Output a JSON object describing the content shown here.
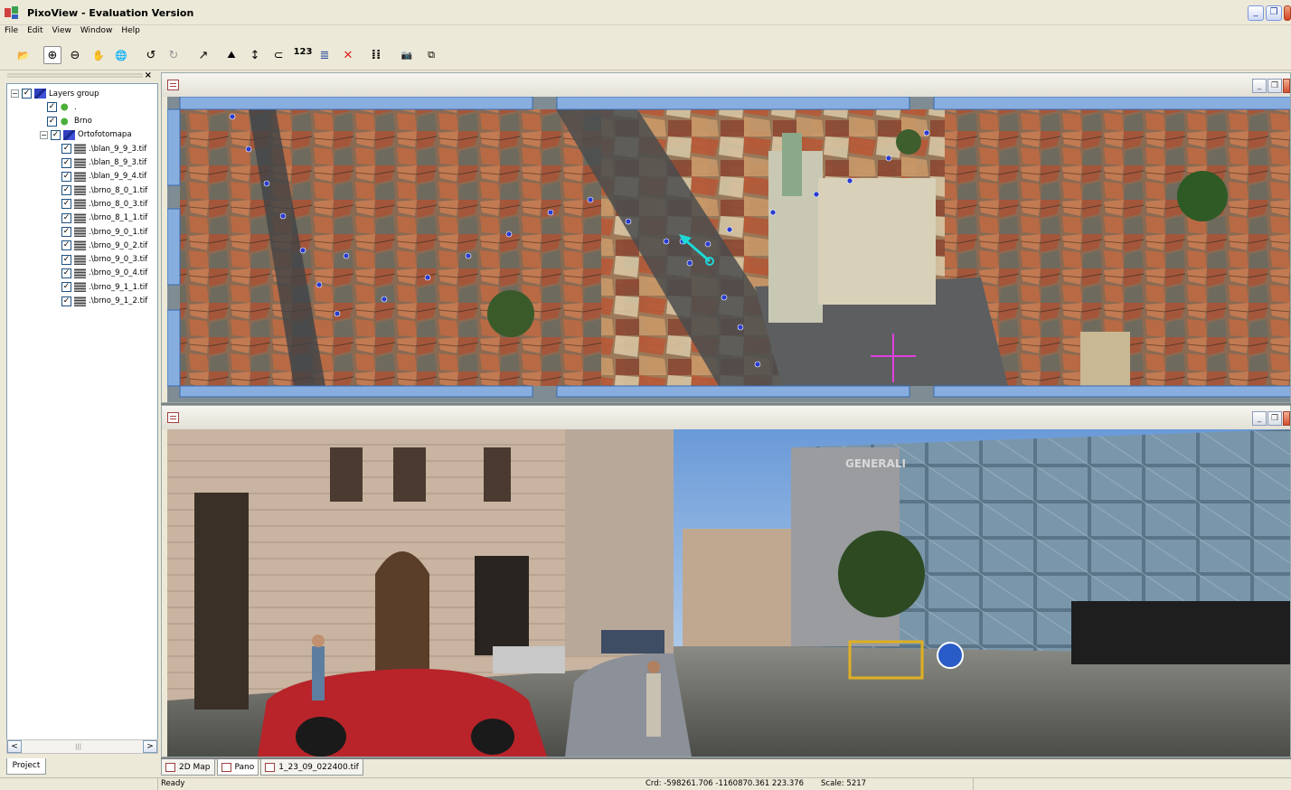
{
  "window": {
    "title": "PixoView - Evaluation Version",
    "min_glyph": "_",
    "max_glyph": "❐"
  },
  "menu": [
    "File",
    "Edit",
    "View",
    "Window",
    "Help"
  ],
  "toolbar": {
    "tools": [
      {
        "name": "open-icon",
        "glyph": "📂"
      },
      {
        "name": "zoom-in-icon",
        "glyph": "⊕"
      },
      {
        "name": "zoom-out-icon",
        "glyph": "⊖"
      },
      {
        "name": "pan-hand-icon",
        "glyph": "✋"
      },
      {
        "name": "globe-icon",
        "glyph": "🌐"
      },
      {
        "name": "rotate-left-icon",
        "glyph": "↺"
      },
      {
        "name": "rotate-right-icon",
        "glyph": "↻"
      },
      {
        "name": "arrow-icon",
        "glyph": "↗"
      },
      {
        "name": "measure-area-icon",
        "glyph": "⛰"
      },
      {
        "name": "measure-height-icon",
        "glyph": "↕"
      },
      {
        "name": "measure-distance-icon",
        "glyph": "⊂"
      },
      {
        "name": "numbering-icon",
        "glyph": "123"
      },
      {
        "name": "layers-list-icon",
        "glyph": "≣"
      },
      {
        "name": "delete-icon",
        "glyph": "✕"
      },
      {
        "name": "points-grid-icon",
        "glyph": "⁞⁞"
      },
      {
        "name": "camera-icon",
        "glyph": "📷"
      },
      {
        "name": "copy-icon",
        "glyph": "⧉"
      }
    ],
    "colors": {
      "delete": "#e02020",
      "globe": "#2a7a30"
    }
  },
  "sidebar": {
    "close_glyph": "×",
    "tree": [
      {
        "level": 0,
        "expander": "⊟",
        "icon": "layers",
        "label": "Layers group"
      },
      {
        "level": 1,
        "icon": "vec",
        "label": "."
      },
      {
        "level": 1,
        "icon": "vec",
        "label": "Brno"
      },
      {
        "level": 1,
        "expander": "⊟",
        "icon": "layers",
        "label": "Ortofotomapa"
      },
      {
        "level": 2,
        "icon": "raster",
        "label": ".\\blan_9_9_3.tif"
      },
      {
        "level": 2,
        "icon": "raster",
        "label": ".\\blan_8_9_3.tif"
      },
      {
        "level": 2,
        "icon": "raster",
        "label": ".\\blan_9_9_4.tif"
      },
      {
        "level": 2,
        "icon": "raster",
        "label": ".\\brno_8_0_1.tif"
      },
      {
        "level": 2,
        "icon": "raster",
        "label": ".\\brno_8_0_3.tif"
      },
      {
        "level": 2,
        "icon": "raster",
        "label": ".\\brno_8_1_1.tif"
      },
      {
        "level": 2,
        "icon": "raster",
        "label": ".\\brno_9_0_1.tif"
      },
      {
        "level": 2,
        "icon": "raster",
        "label": ".\\brno_9_0_2.tif"
      },
      {
        "level": 2,
        "icon": "raster",
        "label": ".\\brno_9_0_3.tif"
      },
      {
        "level": 2,
        "icon": "raster",
        "label": ".\\brno_9_0_4.tif"
      },
      {
        "level": 2,
        "icon": "raster",
        "label": ".\\brno_9_1_1.tif"
      },
      {
        "level": 2,
        "icon": "raster",
        "label": ".\\brno_9_1_2.tif"
      }
    ],
    "checked_glyph": "✓",
    "scroll_left": "<",
    "scroll_right": ">",
    "scroll_grip": "|||",
    "project_tab": "Project"
  },
  "tabs": [
    {
      "label": "2D Map",
      "active": false
    },
    {
      "label": "Pano",
      "active": true
    },
    {
      "label": "1_23_09_022400.tif",
      "active": false
    }
  ],
  "status": {
    "ready": "Ready",
    "coords": "Crd: -598261.706  -1160870.361  223.376",
    "scale": "Scale: 5217"
  },
  "pano": {
    "signs": {
      "generali": "GENERALI"
    }
  },
  "colors": {
    "ortho_frame": "#88aee0",
    "track_points": "#2a3ccf",
    "arrow_cyan": "#1ed8d8",
    "cross_magenta": "#e040e0"
  }
}
